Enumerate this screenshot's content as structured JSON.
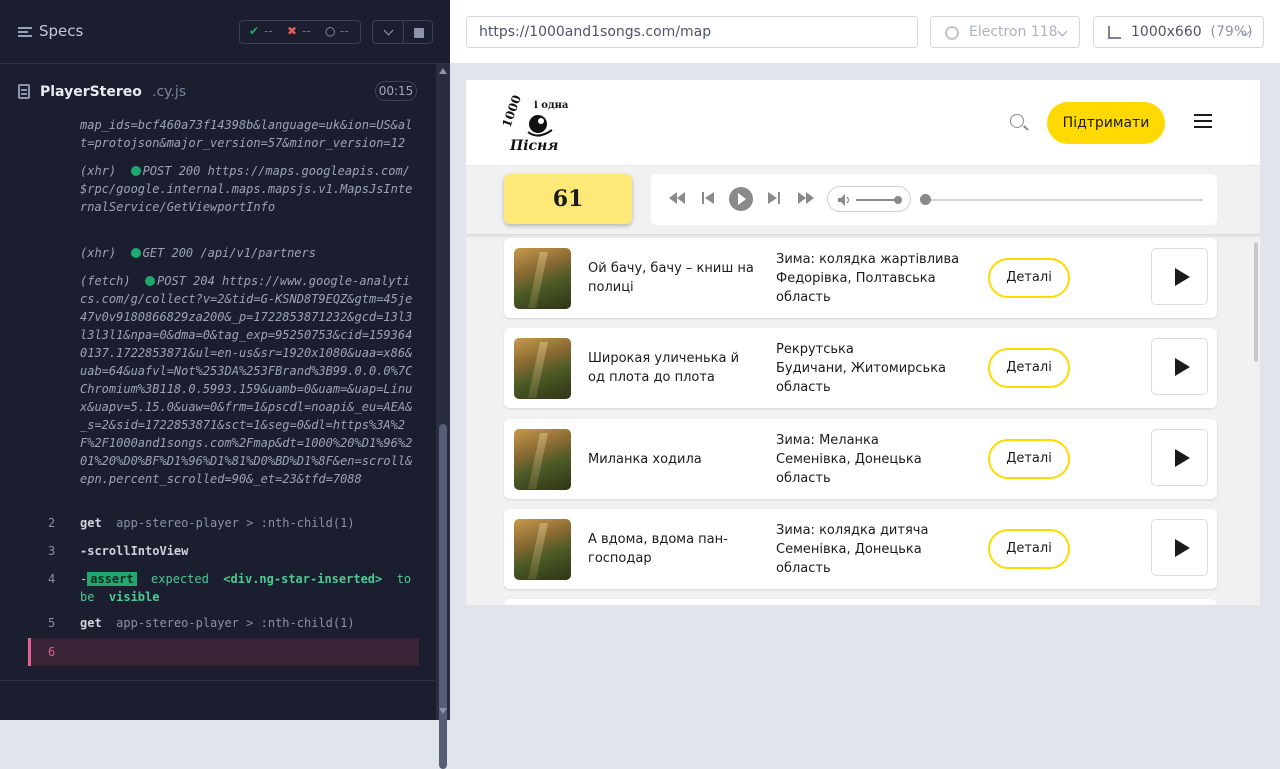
{
  "specs": {
    "title": "Specs",
    "passed_icon": "✔",
    "failed_icon": "✖",
    "pending_icon": "○",
    "dash": "--"
  },
  "file": {
    "name": "PlayerStereo",
    "ext": ".cy.js",
    "timer": "00:15"
  },
  "log": {
    "lines": [
      "map_ids=bcf460a73f14398b&language=uk&ion=US&alt=protojson&major_version=57&minor_version=12",
      "(xhr)",
      "POST 200 https://maps.googleapis.com/$rpc/google.internal.maps.mapsjs.v1.MapsJsInternalService/GetViewportInfo",
      "(xhr)",
      "GET 200 /api/v1/partners",
      "(fetch)",
      "POST 204 https://www.google-analytics.com/g/collect?v=2&tid=G-KSND8T9EQZ&gtm=45je47v0v9180866829za200&_p=1722853871232&gcd=13l3l3l3l1&npa=0&dma=0&tag_exp=95250753&cid=1593640137.1722853871&ul=en-us&sr=1920x1080&uaa=x86&uab=64&uafvl=Not%253DA%253FBrand%3B99.0.0.0%7CChromium%3B118.0.5993.159&uamb=0&uam=&uap=Linux&uapv=5.15.0&uaw=0&frm=1&pscdl=noapi&_eu=AEA&_s=2&sid=1722853871&sct=1&seg=0&dl=https%3A%2F%2F1000and1songs.com%2Fmap&dt=1000%20%D1%96%201%20%D0%BF%D1%96%D1%81%D0%BD%D1%8F&en=scroll&epn.percent_scrolled=90&_et=23&tfd=7088"
    ],
    "commands": [
      {
        "num": "2",
        "cmd": "get",
        "sel": "app-stereo-player > :nth-child(1)"
      },
      {
        "num": "3",
        "cmd": "-scrollIntoView",
        "sel": ""
      },
      {
        "num": "4",
        "cmd": "-",
        "badge": "assert",
        "text1": "expected",
        "text2": "<div.ng-star-inserted>",
        "text3": "to",
        "text4": "be",
        "text5": "visible"
      },
      {
        "num": "5",
        "cmd": "get",
        "sel": "app-stereo-player > :nth-child(1)"
      },
      {
        "num": "6"
      }
    ]
  },
  "browser": {
    "url": "https://1000and1songs.com/map",
    "engine": "Electron 118",
    "viewport": "1000x660",
    "zoom": "(79%)"
  },
  "site": {
    "support_label": "Підтримати",
    "logo_top": "1000 і одна",
    "logo_bottom": "Пісня",
    "counter": "61",
    "songs": [
      {
        "title": "Ой бачу, бачу – книш на полиці",
        "genre": "Зима: колядка жартівлива",
        "place": "Федорівка, Полтавська область",
        "details": "Деталі"
      },
      {
        "title": "Широкая уличенька й од плота до плота",
        "genre": "Рекрутська",
        "place": "Будичани, Житомирська область",
        "details": "Деталі"
      },
      {
        "title": "Миланка ходила",
        "genre": "Зима: Меланка",
        "place": "Семенівка, Донецька область",
        "details": "Деталі"
      },
      {
        "title": "А вдома, вдома пан-господар",
        "genre": "Зима: колядка дитяча",
        "place": "Семенівка, Донецька область",
        "details": "Деталі"
      }
    ]
  },
  "colors": {
    "accent": "#ffd900",
    "counter_bg": "#fde878",
    "runner_bg": "#1b1e2e",
    "pass": "#1fa971",
    "active": "#e05f8d"
  },
  "player": {
    "volume_level": 0.85,
    "progress": 0
  }
}
